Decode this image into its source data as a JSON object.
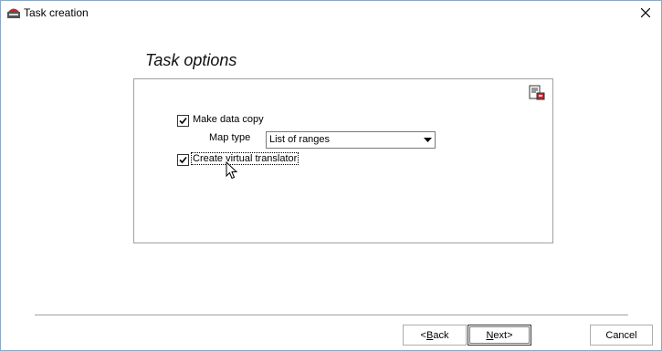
{
  "window": {
    "title": "Task creation",
    "app_icon": "app-icon",
    "close_symbol": "✕"
  },
  "page": {
    "heading": "Task options"
  },
  "options": {
    "make_data_copy": {
      "label": "Make data copy",
      "checked": true
    },
    "map_type": {
      "label": "Map type",
      "value": "List of ranges"
    },
    "create_virtual_translator": {
      "label": "Create virtual translator",
      "checked": true
    },
    "panel_tool_icon": "document-settings-icon"
  },
  "buttons": {
    "back": {
      "mnemonic": "B",
      "rest": "ack",
      "prefix": "<"
    },
    "next": {
      "mnemonic": "N",
      "rest": "ext>",
      "prefix": ""
    },
    "cancel": {
      "label": "Cancel"
    }
  },
  "colors": {
    "window_border": "#8aa9c8",
    "panel_border": "#a0a0a0",
    "app_icon_red": "#c0282d"
  }
}
